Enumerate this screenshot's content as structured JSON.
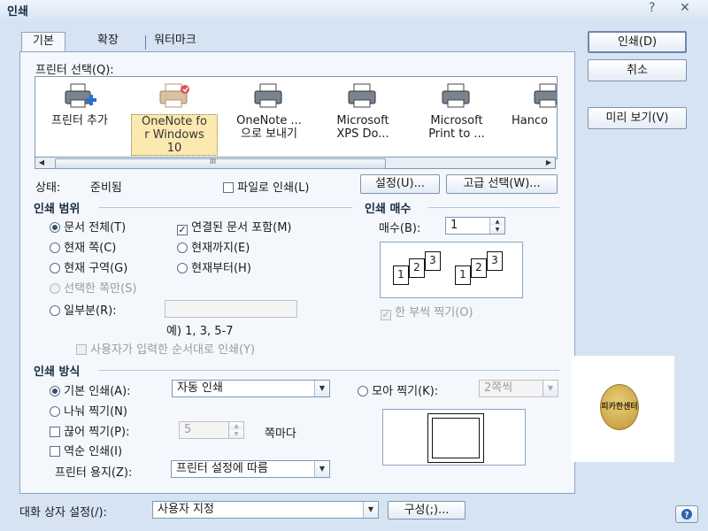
{
  "window": {
    "title": "인쇄",
    "help_glyph": "?",
    "close_glyph": "✕"
  },
  "tabs": [
    "기본",
    "확장",
    "워터마크"
  ],
  "buttons": {
    "print": "인쇄(D)",
    "cancel": "취소",
    "preview": "미리 보기(V)",
    "settings": "설정(U)...",
    "advanced": "고급 선택(W)...",
    "configure": "구성(;)..."
  },
  "printer_select": {
    "label": "프린터 선택(Q):",
    "printers": [
      {
        "line1": "프린터 추가",
        "line2": "",
        "line3": "",
        "icon": "add-printer-icon"
      },
      {
        "line1": "OneNote fo",
        "line2": "r Windows",
        "line3": "10",
        "icon": "printer-icon",
        "selected": true
      },
      {
        "line1": "OneNote ...",
        "line2": "으로 보내기",
        "line3": "",
        "icon": "printer-icon"
      },
      {
        "line1": "Microsoft",
        "line2": "XPS Do...",
        "line3": "",
        "icon": "printer-icon"
      },
      {
        "line1": "Microsoft",
        "line2": "Print to ...",
        "line3": "",
        "icon": "printer-icon"
      },
      {
        "line1": "Hanco",
        "line2": "",
        "line3": "",
        "icon": "printer-icon"
      }
    ],
    "scroll_glyph": "III"
  },
  "status": {
    "label": "상태:",
    "value": "준비됨"
  },
  "print_to_file": "파일로 인쇄(L)",
  "print_range": {
    "title": "인쇄 범위",
    "all_doc": "문서 전체(T)",
    "linked_docs": "연결된 문서 포함(M)",
    "current_page": "현재 쪽(C)",
    "until_current": "현재까지(E)",
    "current_section": "현재 구역(G)",
    "from_current": "현재부터(H)",
    "selection_only": "선택한 쪽만(S)",
    "partial": "일부분(R):",
    "partial_example": "예) 1, 3, 5-7",
    "user_order": "사용자가 입력한 순서대로 인쇄(Y)"
  },
  "copies": {
    "title": "인쇄 매수",
    "label": "매수(B):",
    "value": "1",
    "collate": "한 부씩 찍기(O)",
    "check_glyph": "✓",
    "page_numbers": [
      "1",
      "2",
      "3"
    ]
  },
  "print_method": {
    "title": "인쇄 방식",
    "basic": "기본 인쇄(A):",
    "basic_value": "자동 인쇄",
    "collect": "모아 찍기(K):",
    "collect_value": "2쪽씩",
    "split": "나눠 찍기(N)",
    "interrupt": "끊어 찍기(P):",
    "interrupt_value": "5",
    "every_page": "쪽마다",
    "reverse": "역순 인쇄(I)",
    "paper_label": "프린터 용지(Z):",
    "paper_value": "프린터 설정에 따름"
  },
  "dialog_settings": {
    "label": "대화 상자 설정(/):",
    "value": "사용자 지정"
  },
  "seal_text": "피카한센터",
  "colors": {
    "accent": "#6d87ad",
    "panel_bg": "#f4f8fd",
    "dialog_bg": "#d6e3f3"
  }
}
